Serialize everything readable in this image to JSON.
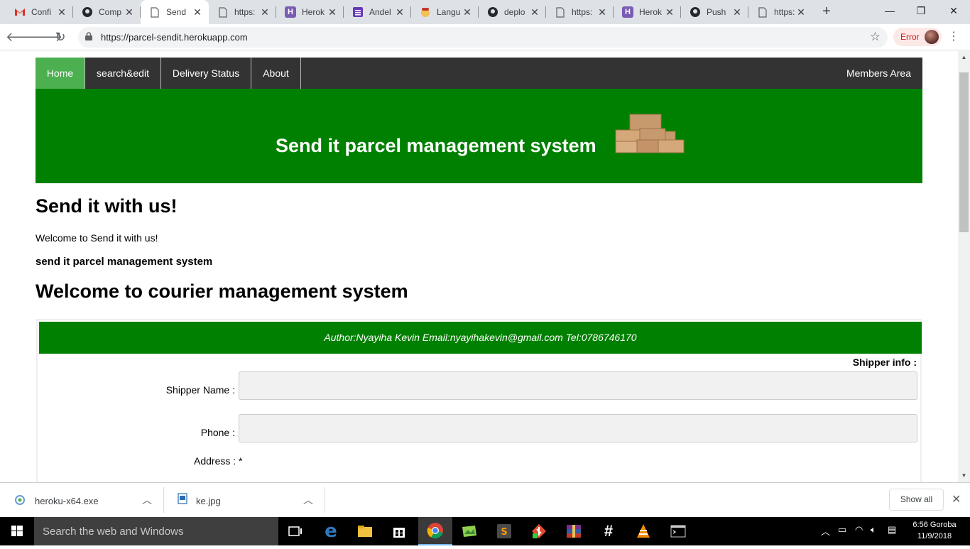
{
  "browser": {
    "tabs": [
      {
        "label": "Confi",
        "icon": "gmail-icon"
      },
      {
        "label": "Comp",
        "icon": "github-icon"
      },
      {
        "label": "Send",
        "icon": "page-icon",
        "active": true
      },
      {
        "label": "https:",
        "icon": "page-icon"
      },
      {
        "label": "Herok",
        "icon": "heroku-icon"
      },
      {
        "label": "Andel",
        "icon": "form-icon"
      },
      {
        "label": "Langu",
        "icon": "emoji-icon"
      },
      {
        "label": "deplo",
        "icon": "github-icon"
      },
      {
        "label": "https:",
        "icon": "page-icon"
      },
      {
        "label": "Herok",
        "icon": "heroku-icon"
      },
      {
        "label": "Push",
        "icon": "github-icon"
      },
      {
        "label": "https:",
        "icon": "page-icon"
      }
    ],
    "url": "https://parcel-sendit.herokuapp.com",
    "error_label": "Error"
  },
  "site": {
    "nav": {
      "home": "Home",
      "search_edit": "search&edit",
      "delivery_status": "Delivery Status",
      "about": "About",
      "members": "Members Area"
    },
    "hero_title": "Send it parcel management system",
    "heading1": "Send it with us!",
    "welcome_text": "Welcome to Send it with us!",
    "subheading": "send it parcel management system",
    "heading2": "Welcome to courier management system",
    "author_line": "Author:Nyayiha Kevin Email:nyayihakevin@gmail.com Tel:0786746170",
    "form": {
      "section_title": "Shipper info :",
      "shipper_name_label": "Shipper Name :",
      "shipper_name_value": "",
      "phone_label": "Phone :",
      "phone_value": "",
      "address_label": "Address : *"
    }
  },
  "downloads": {
    "items": [
      {
        "name": "heroku-x64.exe"
      },
      {
        "name": "ke.jpg"
      }
    ],
    "show_all": "Show all"
  },
  "taskbar": {
    "search_placeholder": "Search the web and Windows",
    "time": "6:56 Goroba",
    "date": "11/9/2018"
  },
  "colors": {
    "nav_bg": "#333333",
    "nav_active": "#4caf50",
    "hero_bg": "#008000"
  }
}
